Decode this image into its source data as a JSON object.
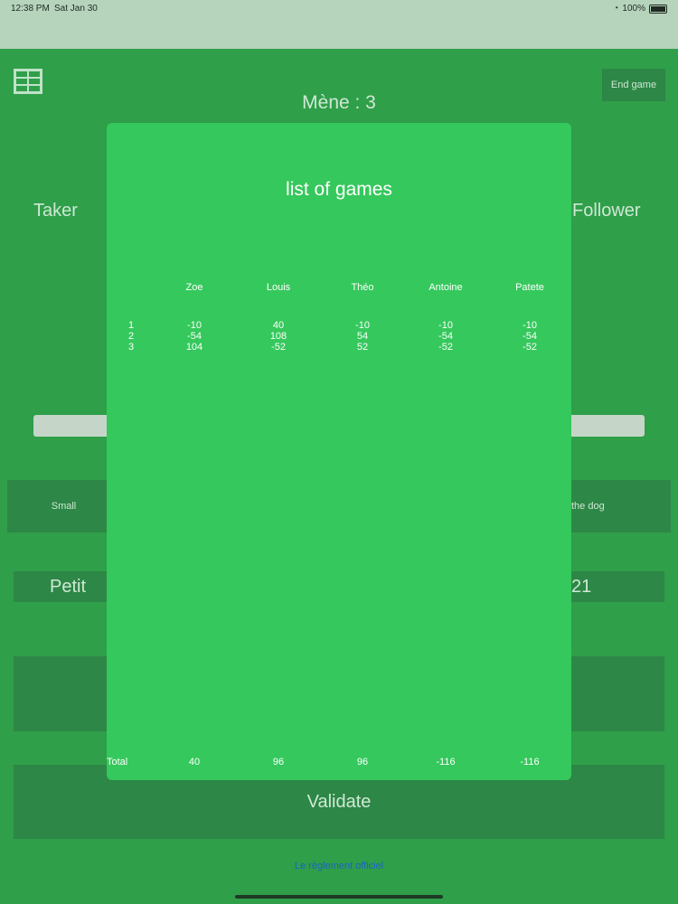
{
  "status_bar": {
    "time": "12:38 PM",
    "date": "Sat Jan 30",
    "battery": "100%"
  },
  "header": {
    "end_game_label": "End game",
    "mene_label": "Mène : 3"
  },
  "background": {
    "taker_label": "Taker",
    "follower_label": "Follower",
    "small_label": "Small",
    "dog_label": "the dog",
    "petit_label": "Petit",
    "score_label": "21",
    "validate_label": "Validate",
    "rules_link": "Le règlement officiel"
  },
  "modal": {
    "title": "list of games",
    "players": [
      "Zoe",
      "Louis",
      "Théo",
      "Antoine",
      "Patete"
    ],
    "rows": [
      {
        "index": "1",
        "scores": [
          "-10",
          "40",
          "-10",
          "-10",
          "-10"
        ]
      },
      {
        "index": "2",
        "scores": [
          "-54",
          "108",
          "54",
          "-54",
          "-54"
        ]
      },
      {
        "index": "3",
        "scores": [
          "104",
          "-52",
          "52",
          "-52",
          "-52"
        ]
      }
    ],
    "total_label": "Total",
    "totals": [
      "40",
      "96",
      "96",
      "-116",
      "-116"
    ]
  },
  "colors": {
    "background": "#2f9f49",
    "modal": "#35c85c",
    "link": "#1a63c7"
  }
}
